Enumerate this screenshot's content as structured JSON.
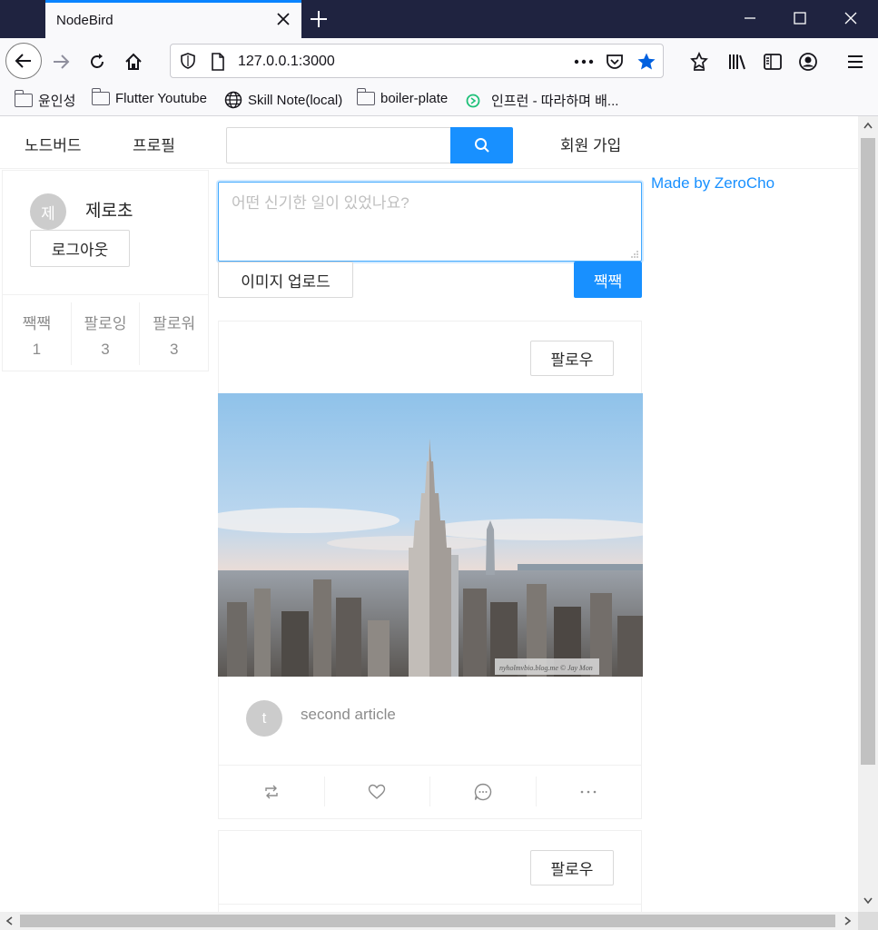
{
  "browser": {
    "tab_title": "NodeBird",
    "url": "127.0.0.1:3000",
    "bookmarks": [
      {
        "label": "윤인성",
        "icon": "folder-icon"
      },
      {
        "label": "Flutter Youtube",
        "icon": "folder-icon"
      },
      {
        "label": "Skill Note(local)",
        "icon": "globe-icon"
      },
      {
        "label": "boiler-plate",
        "icon": "folder-icon"
      },
      {
        "label": "인프런 - 따라하며 배...",
        "icon": "inflearn-icon"
      }
    ]
  },
  "menu": {
    "home": "노드버드",
    "profile": "프로필",
    "search_placeholder": "",
    "signup": "회원 가입"
  },
  "user": {
    "avatar_initial": "제",
    "nickname": "제로초",
    "logout_label": "로그아웃",
    "stats": [
      {
        "label": "짹짹",
        "value": "1"
      },
      {
        "label": "팔로잉",
        "value": "3"
      },
      {
        "label": "팔로워",
        "value": "3"
      }
    ]
  },
  "post_form": {
    "placeholder": "어떤 신기한 일이 있었나요?",
    "upload_label": "이미지 업로드",
    "submit_label": "짹짹"
  },
  "posts": [
    {
      "follow_label": "팔로우",
      "avatar_initial": "t",
      "content": "second article",
      "image_watermark": "nyholmvbio.blog.me © Jay Mon"
    },
    {
      "follow_label": "팔로우"
    }
  ],
  "footer_link": "Made by ZeroCho",
  "colors": {
    "primary": "#1890ff",
    "border": "#f0f0f0",
    "avatar": "#cccccc"
  }
}
